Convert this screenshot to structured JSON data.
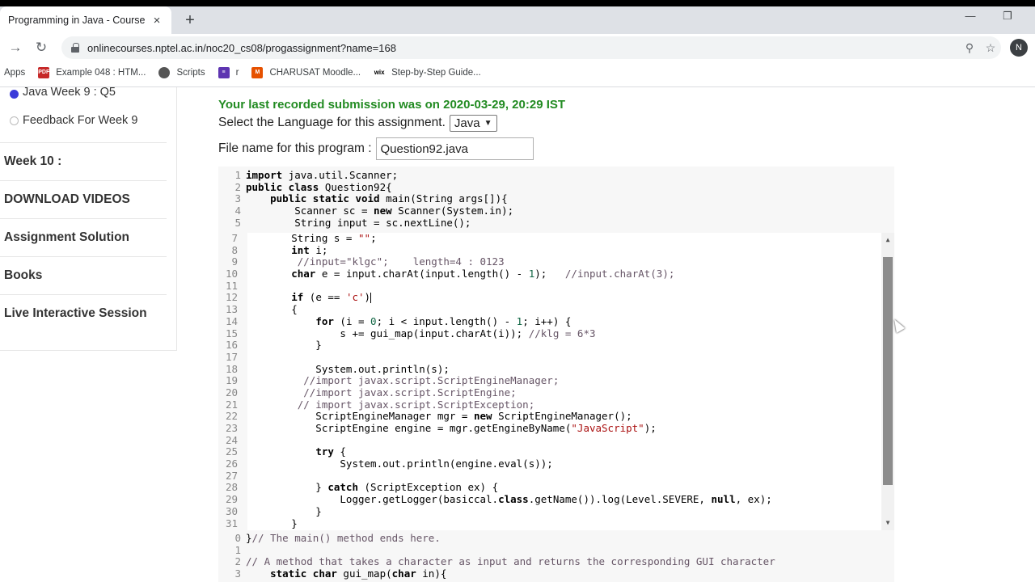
{
  "browser": {
    "tab_title": "Programming in Java - Course",
    "tab_close": "×",
    "new_tab": "+",
    "url": "onlinecourses.nptel.ac.in/noc20_cs08/progassignment?name=168",
    "avatar_letter": "N",
    "bookmarks": [
      {
        "label": "Apps",
        "icon": "apps-grid-icon"
      },
      {
        "label": "Example 048 : HTM...",
        "icon": "pdf-icon"
      },
      {
        "label": "Scripts",
        "icon": "globe-icon"
      },
      {
        "label": "r",
        "icon": "list-icon"
      },
      {
        "label": "CHARUSAT Moodle...",
        "icon": "moodle-icon"
      },
      {
        "label": "Step-by-Step Guide...",
        "icon": "wix-icon"
      }
    ]
  },
  "sidebar": {
    "subitems": [
      {
        "label": "Java Week 9 : Q5",
        "selected": true
      },
      {
        "label": "Feedback For Week 9",
        "selected": false
      }
    ],
    "headings": [
      "Week 10 :",
      "DOWNLOAD VIDEOS",
      "Assignment Solution",
      "Books",
      "Live Interactive Session"
    ]
  },
  "main": {
    "last_submission": "Your last recorded submission was on 2020-03-29, 20:29 IST",
    "language_label": "Select the Language for this assignment.",
    "language_value": "Java",
    "filename_label": "File name for this program :",
    "filename_value": "Question92.java"
  },
  "code": {
    "top": [
      {
        "n": "1",
        "html": "<span class='kw'>import</span> java.util.Scanner;"
      },
      {
        "n": "2",
        "html": "<span class='kw'>public class</span> Question92{"
      },
      {
        "n": "3",
        "html": "    <span class='kw'>public static void</span> main(String args[]){"
      },
      {
        "n": "4",
        "html": "        Scanner sc = <span class='kw'>new</span> Scanner(System.in);"
      },
      {
        "n": "5",
        "html": "        String input = sc.nextLine();"
      }
    ],
    "middle": [
      {
        "n": "7",
        "html": "        String s = <span class='str'>\"\"</span>;"
      },
      {
        "n": "8",
        "html": "        <span class='kw'>int</span> i;"
      },
      {
        "n": "9",
        "html": "         <span class='cm'>//input=\"klgc\";    length=4 : 0123</span>"
      },
      {
        "n": "10",
        "html": "        <span class='kw'>char</span> e = input.charAt(input.length() - <span class='num'>1</span>);   <span class='cm'>//input.charAt(3);</span>"
      },
      {
        "n": "11",
        "html": ""
      },
      {
        "n": "12",
        "html": "        <span class='kw'>if</span> (e == <span class='str'>'c'</span>)<span class='cursor'></span>"
      },
      {
        "n": "13",
        "html": "        {"
      },
      {
        "n": "14",
        "html": "            <span class='kw'>for</span> (i = <span class='num'>0</span>; i &lt; input.length() - <span class='num'>1</span>; i++) {"
      },
      {
        "n": "15",
        "html": "                s += gui_map(input.charAt(i)); <span class='cm'>//klg = 6*3</span>"
      },
      {
        "n": "16",
        "html": "            }"
      },
      {
        "n": "17",
        "html": ""
      },
      {
        "n": "18",
        "html": "            System.out.println(s);"
      },
      {
        "n": "19",
        "html": "          <span class='cm'>//import javax.script.ScriptEngineManager;</span>"
      },
      {
        "n": "20",
        "html": "          <span class='cm'>//import javax.script.ScriptEngine;</span>"
      },
      {
        "n": "21",
        "html": "         <span class='cm'>// import javax.script.ScriptException;</span>"
      },
      {
        "n": "22",
        "html": "            ScriptEngineManager mgr = <span class='kw'>new</span> ScriptEngineManager();"
      },
      {
        "n": "23",
        "html": "            ScriptEngine engine = mgr.getEngineByName(<span class='str'>\"JavaScript\"</span>);"
      },
      {
        "n": "24",
        "html": ""
      },
      {
        "n": "25",
        "html": "            <span class='kw'>try</span> {"
      },
      {
        "n": "26",
        "html": "                System.out.println(engine.eval(s));"
      },
      {
        "n": "27",
        "html": ""
      },
      {
        "n": "28",
        "html": "            } <span class='kw'>catch</span> (ScriptException ex) {"
      },
      {
        "n": "29",
        "html": "                Logger.getLogger(basiccal.<span class='kw'>class</span>.getName()).log(Level.SEVERE, <span class='kw'>null</span>, ex);"
      },
      {
        "n": "30",
        "html": "            }"
      },
      {
        "n": "31",
        "html": "        }"
      }
    ],
    "bottom": [
      {
        "n": "0",
        "html": "}<span class='cm'>// The main() method ends here.</span>"
      },
      {
        "n": "1",
        "html": ""
      },
      {
        "n": "2",
        "html": "<span class='cm'>// A method that takes a character as input and returns the corresponding GUI character</span>"
      },
      {
        "n": "3",
        "html": "    <span class='kw'>static char</span> gui_map(<span class='kw'>char</span> in){"
      }
    ]
  }
}
